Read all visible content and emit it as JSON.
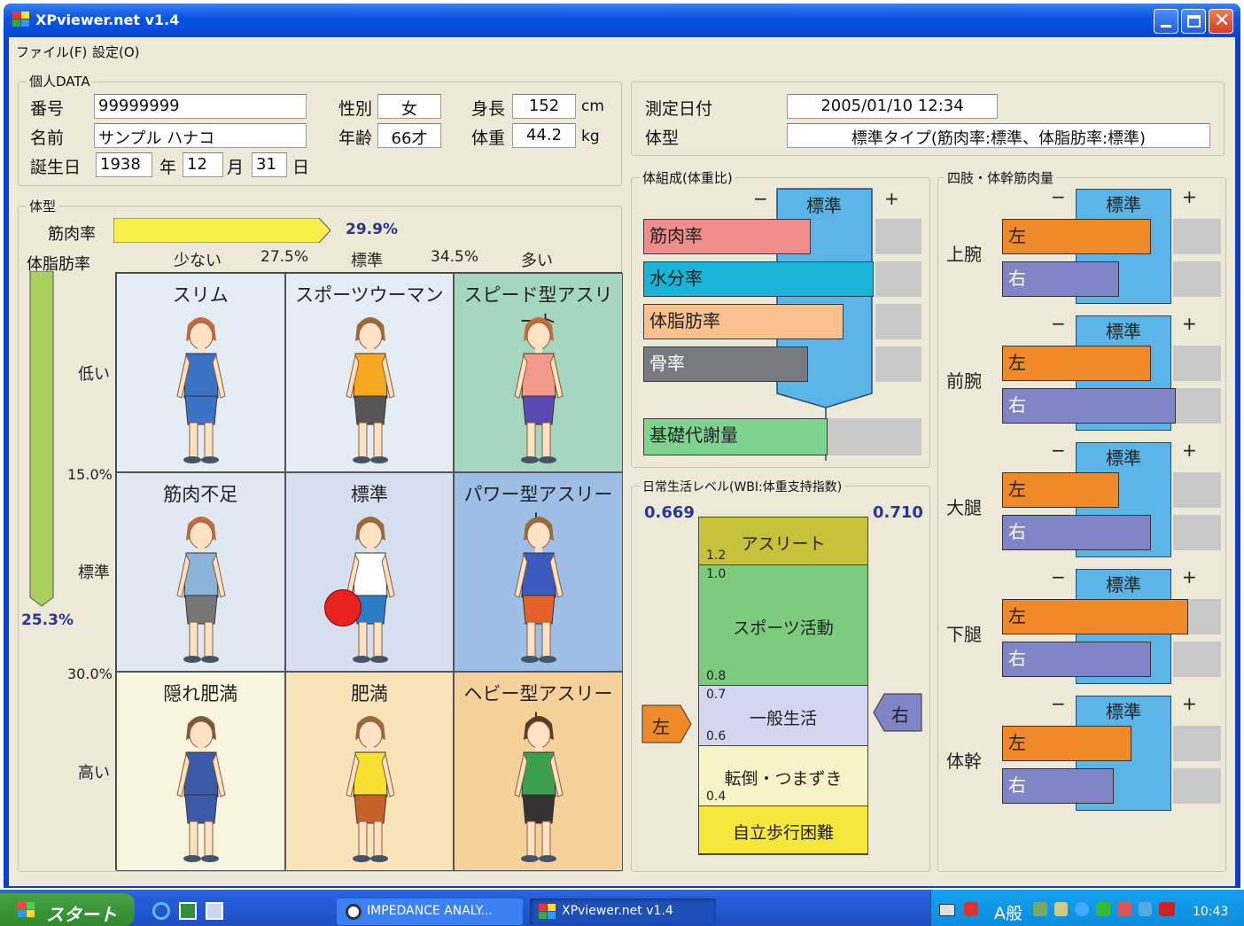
{
  "window": {
    "title": "XPviewer.net v1.4"
  },
  "menu": [
    "ファイル(F)",
    "設定(O)"
  ],
  "personal": {
    "group": "個人DATA",
    "id_label": "番号",
    "id": "99999999",
    "name_label": "名前",
    "name": "サンプル ハナコ",
    "birth_label": "誕生日",
    "birth_year": "1938",
    "year_unit": "年",
    "birth_month": "12",
    "month_unit": "月",
    "birth_day": "31",
    "day_unit": "日",
    "sex_label": "性別",
    "sex": "女",
    "age_label": "年齢",
    "age": "66才",
    "height_label": "身長",
    "height": "152",
    "height_unit": "cm",
    "weight_label": "体重",
    "weight": "44.2",
    "weight_unit": "kg"
  },
  "measure": {
    "date_label": "測定日付",
    "date": "2005/01/10 12:34",
    "type_label": "体型",
    "type": "標準タイプ(筋肉率:標準、体脂肪率:標準)"
  },
  "bodytype": {
    "group": "体型",
    "muscle_label": "筋肉率",
    "muscle_value": "29.9%",
    "muscle_fraction": 0.86,
    "fat_label": "体脂肪率",
    "fat_value": "25.3%",
    "fat_fraction": 0.6,
    "x_axis": [
      "少ない",
      "27.5%",
      "標準",
      "34.5%",
      "多い"
    ],
    "y_axis": {
      "low": "低い",
      "t1": "15.0%",
      "std": "標準",
      "t2": "30.0%",
      "high": "高い"
    },
    "cells": [
      "スリム",
      "スポーツウーマン",
      "スピード型アスリート",
      "筋肉不足",
      "標準",
      "パワー型アスリート",
      "隠れ肥満",
      "肥満",
      "ヘビー型アスリート"
    ],
    "cell_colors": [
      "#e4edf3",
      "#e4edf3",
      "#a5d6c0",
      "#e0e9f2",
      "#d6dff0",
      "#9dbfe6",
      "#f7f5dd",
      "#f8e4b8",
      "#f7d19a"
    ]
  },
  "composition": {
    "group": "体組成(体重比)",
    "minus": "−",
    "plus": "+",
    "standard": "標準",
    "items": [
      {
        "label": "筋肉率",
        "color": "#f08c8c"
      },
      {
        "label": "水分率",
        "color": "#1ab3d8"
      },
      {
        "label": "体脂肪率",
        "color": "#f7c08c"
      },
      {
        "label": "骨率",
        "color": "#777a7e"
      }
    ],
    "bmr": {
      "label": "基礎代謝量",
      "color": "#7ed38e"
    }
  },
  "wbi": {
    "group": "日常生活レベル(WBI:体重支持指数)",
    "left_value": "0.669",
    "right_value": "0.710",
    "left": "左",
    "right": "右",
    "bands": [
      {
        "label": "アスリート",
        "tick": "1.2",
        "color": "#c6c23a"
      },
      {
        "label": "スポーツ活動",
        "tick_top": "1.0",
        "tick": "0.8",
        "color": "#7dcc7d"
      },
      {
        "label": "一般生活",
        "tick_top": "0.7",
        "tick": "0.6",
        "color": "#d2d6ee"
      },
      {
        "label": "転倒・つまずき",
        "tick": "0.4",
        "color": "#f6f3c8"
      },
      {
        "label": "自立歩行困難",
        "color": "#f5e83a"
      }
    ]
  },
  "limbs": {
    "group": "四肢・体幹筋肉量",
    "minus": "−",
    "plus": "+",
    "standard": "標準",
    "left": "左",
    "right": "右",
    "parts": [
      {
        "name": "上腕",
        "left_fraction": 0.6,
        "right_fraction": 0.47
      },
      {
        "name": "前腕",
        "left_fraction": 0.6,
        "right_fraction": 0.7
      },
      {
        "name": "大腿",
        "left_fraction": 0.47,
        "right_fraction": 0.6
      },
      {
        "name": "下腿",
        "left_fraction": 0.75,
        "right_fraction": 0.6
      },
      {
        "name": "体幹",
        "left_fraction": 0.52,
        "right_fraction": 0.45
      }
    ]
  },
  "taskbar": {
    "start": "スタート",
    "task1": "IMPEDANCE ANALY...",
    "task2": "XPviewer.net v1.4",
    "ime": "A般",
    "time": "10:43"
  }
}
